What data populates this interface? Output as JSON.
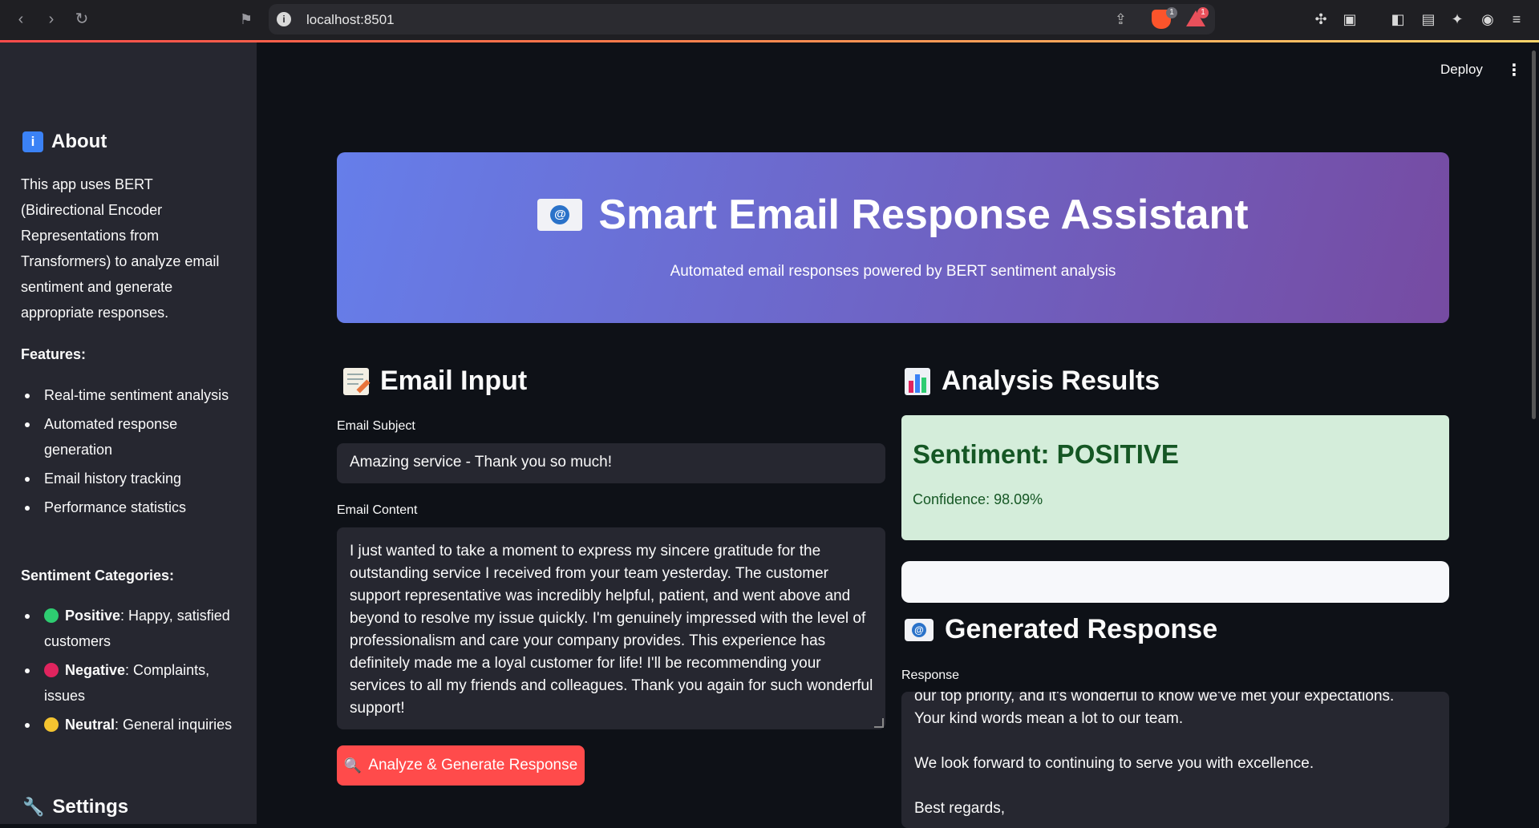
{
  "browser": {
    "url": "localhost:8501",
    "brave_badge": "1",
    "bat_badge": "1"
  },
  "sidebar": {
    "about_heading": "About",
    "about_text": "This app uses BERT (Bidirectional Encoder Representations from Transformers) to analyze email sentiment and generate appropriate responses.",
    "features_heading": "Features:",
    "features": [
      "Real-time sentiment analysis",
      "Automated response generation",
      "Email history tracking",
      "Performance statistics"
    ],
    "categories_heading": "Sentiment Categories:",
    "categories": [
      {
        "name": "Positive",
        "desc": ": Happy, satisfied customers",
        "color": "#2ecc71"
      },
      {
        "name": "Negative",
        "desc": ": Complaints, issues",
        "color": "#e0245e"
      },
      {
        "name": "Neutral",
        "desc": ": General inquiries",
        "color": "#f4c430"
      }
    ],
    "settings_heading": "Settings"
  },
  "header": {
    "deploy_label": "Deploy",
    "menu_icon": "⋮"
  },
  "hero": {
    "title": "Smart Email Response Assistant",
    "subtitle": "Automated email responses powered by BERT sentiment analysis",
    "gradient_start": "#667eea",
    "gradient_end": "#764ba2"
  },
  "input": {
    "heading": "Email Input",
    "subject_label": "Email Subject",
    "subject_value": "Amazing service - Thank you so much!",
    "content_label": "Email Content",
    "content_value": "I just wanted to take a moment to express my sincere gratitude for the outstanding service I received from your team yesterday. The customer support representative was incredibly helpful, patient, and went above and beyond to resolve my issue quickly. I'm genuinely impressed with the level of professionalism and care your company provides. This experience has definitely made me a loyal customer for life! I'll be recommending your services to all my friends and colleagues. Thank you again for such wonderful support!",
    "button_label": "Analyze & Generate Response",
    "button_color": "#ff4b4b"
  },
  "results": {
    "heading": "Analysis Results",
    "sentiment_title": "Sentiment: POSITIVE",
    "confidence": "Confidence: 98.09%",
    "response_heading": "Generated Response",
    "response_label": "Response",
    "response_text": "our top priority, and it's wonderful to know we've met your expectations.\nYour kind words mean a lot to our team.\n\nWe look forward to continuing to serve you with excellence.\n\nBest regards,"
  }
}
